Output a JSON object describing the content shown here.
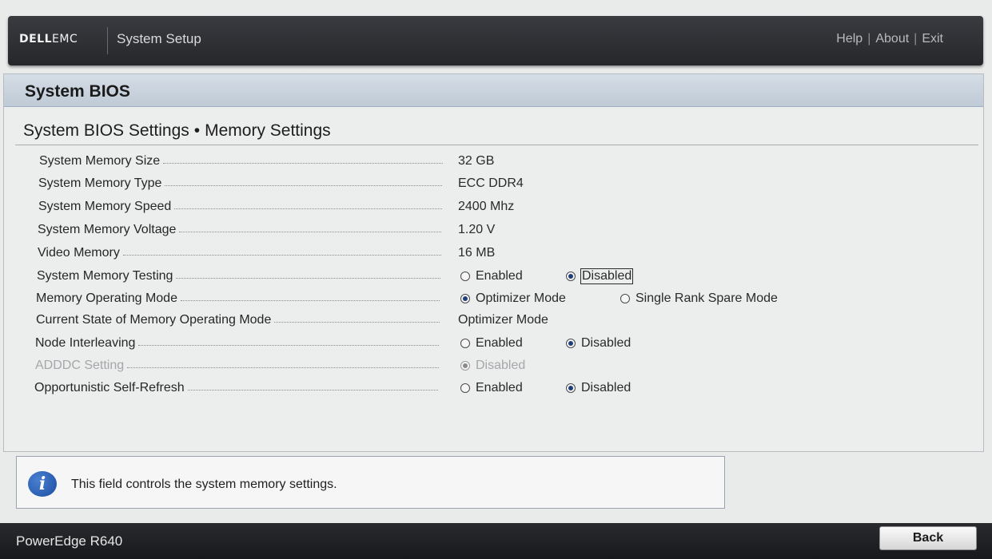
{
  "header": {
    "brand_dell": "DELL",
    "brand_emc": "EMC",
    "app_title": "System Setup",
    "links": {
      "help": "Help",
      "about": "About",
      "exit": "Exit",
      "separator": "|"
    }
  },
  "panel": {
    "title": "System BIOS",
    "breadcrumb": {
      "parent": "System BIOS Settings",
      "separator": "•",
      "current": "Memory Settings"
    }
  },
  "settings": {
    "memory_size": {
      "label": "System Memory Size",
      "value": "32 GB"
    },
    "memory_type": {
      "label": "System Memory Type",
      "value": "ECC DDR4"
    },
    "memory_speed": {
      "label": "System Memory Speed",
      "value": "2400 Mhz"
    },
    "memory_voltage": {
      "label": "System Memory Voltage",
      "value": "1.20 V"
    },
    "video_memory": {
      "label": "Video Memory",
      "value": "16 MB"
    },
    "memory_testing": {
      "label": "System Memory Testing",
      "option_a": "Enabled",
      "option_b": "Disabled",
      "selected": "Disabled"
    },
    "operating_mode": {
      "label": "Memory Operating Mode",
      "option_a": "Optimizer Mode",
      "option_b": "Single Rank Spare Mode",
      "selected": "Optimizer Mode"
    },
    "current_mode": {
      "label": "Current State of Memory Operating Mode",
      "value": "Optimizer Mode"
    },
    "node_interleaving": {
      "label": "Node Interleaving",
      "option_a": "Enabled",
      "option_b": "Disabled",
      "selected": "Disabled"
    },
    "adddc": {
      "label": "ADDDC Setting",
      "option_a": "Disabled",
      "selected": "Disabled",
      "state": "greyed-out"
    },
    "self_refresh": {
      "label": "Opportunistic Self-Refresh",
      "option_a": "Enabled",
      "option_b": "Disabled",
      "selected": "Disabled"
    }
  },
  "help": {
    "icon": "info-icon",
    "text": "This field controls the system memory settings."
  },
  "footer": {
    "model": "PowerEdge R640",
    "back_label": "Back"
  },
  "colors": {
    "header_bg": "#2f3034",
    "panel_header_bg": "#c9d3de",
    "radio_selected": "#1d3f7a",
    "disabled_text": "#a5a7aa"
  }
}
